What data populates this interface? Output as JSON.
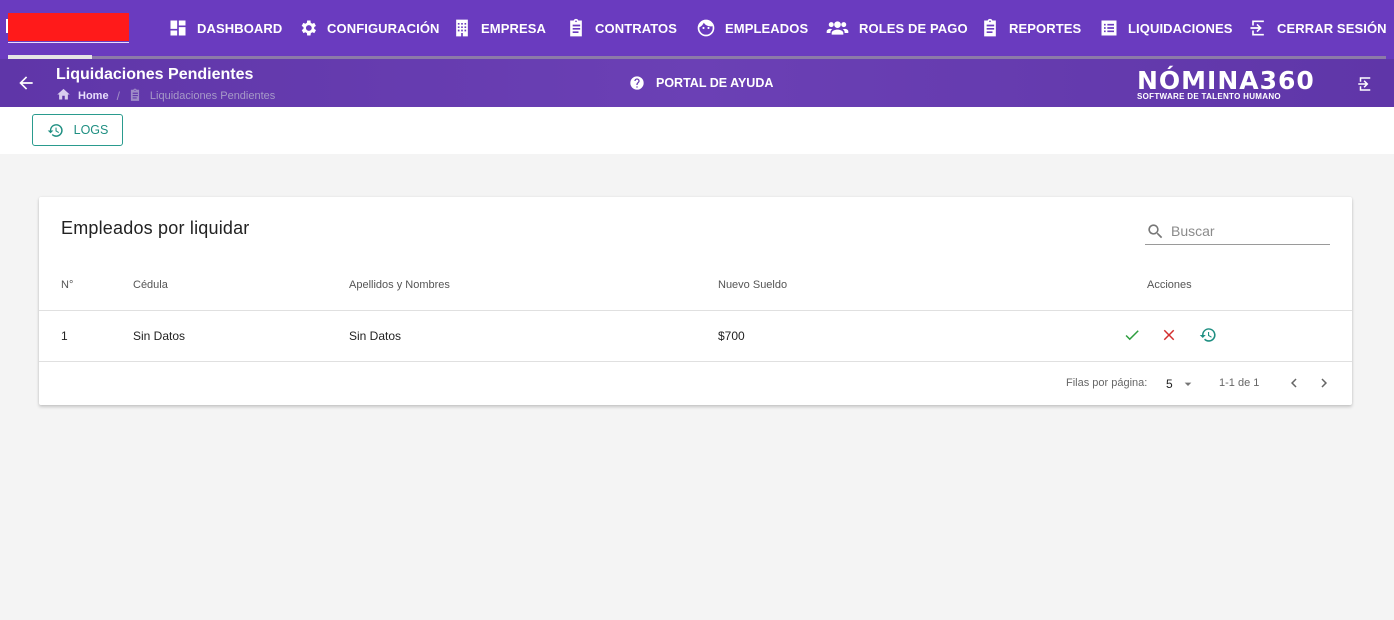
{
  "nav": {
    "items": [
      {
        "label": "DASHBOARD",
        "icon": "dashboard-icon"
      },
      {
        "label": "CONFIGURACIÓN",
        "icon": "gear-icon"
      },
      {
        "label": "EMPRESA",
        "icon": "building-icon"
      },
      {
        "label": "CONTRATOS",
        "icon": "clipboard-icon"
      },
      {
        "label": "EMPLEADOS",
        "icon": "face-icon"
      },
      {
        "label": "ROLES DE PAGO",
        "icon": "group-icon"
      },
      {
        "label": "REPORTES",
        "icon": "report-icon"
      },
      {
        "label": "LIQUIDACIONES",
        "icon": "list-icon"
      },
      {
        "label": "CERRAR SESIÓN",
        "icon": "logout-icon"
      }
    ]
  },
  "header": {
    "title": "Liquidaciones Pendientes",
    "breadcrumb_home": "Home",
    "breadcrumb_separator": "/",
    "breadcrumb_current": "Liquidaciones Pendientes",
    "help_label": "PORTAL DE AYUDA",
    "brand_name": "NÓMINA360",
    "brand_tagline": "SOFTWARE DE TALENTO HUMANO"
  },
  "toolbar": {
    "logs_label": "LOGS"
  },
  "table": {
    "title": "Empleados por liquidar",
    "search_placeholder": "Buscar",
    "columns": [
      "N°",
      "Cédula",
      "Apellidos y Nombres",
      "Nuevo Sueldo",
      "Acciones"
    ],
    "rows": [
      {
        "n": "1",
        "cedula": "Sin Datos",
        "nombres": "Sin Datos",
        "sueldo": "$700"
      }
    ],
    "actions": [
      "check-icon",
      "close-icon",
      "history-icon"
    ],
    "rows_per_page_label": "Filas por página:",
    "rows_per_page": "5",
    "range": "1-1 de 1"
  },
  "colors": {
    "nav_bg": "#6a3bbf",
    "accent_teal": "#1f8f82",
    "approve_green": "#2e9e3f",
    "reject_red": "#d32f2f",
    "logo_red": "#ff1a1a"
  }
}
